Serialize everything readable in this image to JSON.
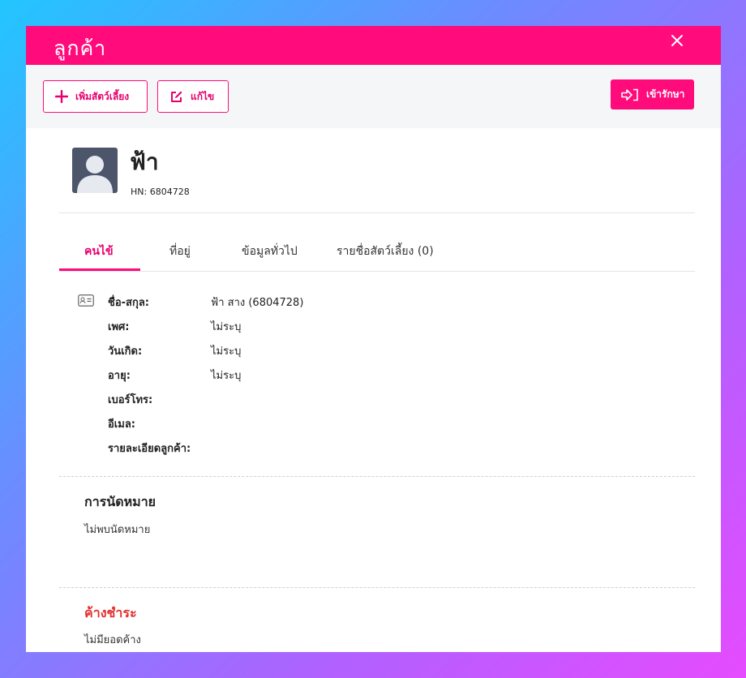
{
  "modal": {
    "title": "ลูกค้า"
  },
  "toolbar": {
    "add_pet_label": "เพิ่มสัตว์เลี้ยง",
    "edit_label": "แก้ไข",
    "admit_label": "เข้ารักษา"
  },
  "profile": {
    "name": "ฟ้า",
    "hn": "HN: 6804728"
  },
  "tabs": [
    {
      "label": "คนไข้"
    },
    {
      "label": "ที่อยู่"
    },
    {
      "label": "ข้อมูลทั่วไป"
    },
    {
      "label": "รายชื่อสัตว์เลี้ยง (0)"
    }
  ],
  "info": [
    {
      "label": "ชื่อ-สกุล:",
      "value": "ฟ้า สาง (6804728)"
    },
    {
      "label": "เพศ:",
      "value": "ไม่ระบุ"
    },
    {
      "label": "วันเกิด:",
      "value": "ไม่ระบุ"
    },
    {
      "label": "อายุ:",
      "value": "ไม่ระบุ"
    },
    {
      "label": "เบอร์โทร:",
      "value": ""
    },
    {
      "label": "อีเมล:",
      "value": ""
    },
    {
      "label": "รายละเอียดลูกค้า:",
      "value": ""
    }
  ],
  "appointments": {
    "title": "การนัดหมาย",
    "empty_text": "ไม่พบนัดหมาย"
  },
  "outstanding": {
    "title": "ค้างชำระ",
    "empty_text": "ไม่มียอดค้าง"
  },
  "colors": {
    "accent": "#ff0b7b",
    "accent_text": "#e6006d",
    "danger": "#e33030"
  },
  "icons": {
    "close": "close-icon",
    "add": "plus-icon",
    "edit": "edit-icon",
    "admit": "enter-icon",
    "avatar": "user-avatar-icon",
    "id_card": "id-card-icon"
  }
}
